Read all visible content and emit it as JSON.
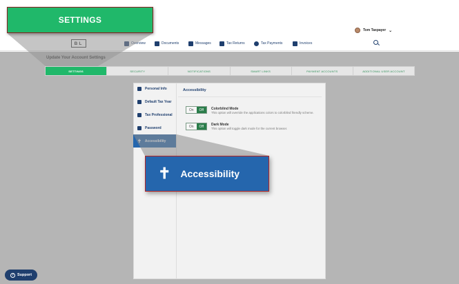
{
  "user": {
    "name": "Tom Taxpayer",
    "caret": "⌄"
  },
  "logo": "BL",
  "nav": [
    {
      "label": "Overview",
      "icon": "home-icon"
    },
    {
      "label": "Documents",
      "icon": "documents-icon"
    },
    {
      "label": "Messages",
      "icon": "messages-icon"
    },
    {
      "label": "Tax Returns",
      "icon": "tax-returns-icon"
    },
    {
      "label": "Tax Payments",
      "icon": "dollar-icon"
    },
    {
      "label": "Invoices",
      "icon": "invoice-icon"
    }
  ],
  "page_heading": "Update Your Account Settings",
  "tabs": [
    {
      "label": "SETTINGS",
      "active": true
    },
    {
      "label": "SECURITY",
      "active": false
    },
    {
      "label": "NOTIFICATIONS",
      "active": false
    },
    {
      "label": "SMART LINKS",
      "active": false
    },
    {
      "label": "PAYMENT ACCOUNTS",
      "active": false
    },
    {
      "label": "ADDITIONAL USER ACCOUNT",
      "active": false
    }
  ],
  "sidebar": [
    {
      "label": "Personal Info",
      "icon": "person-icon",
      "active": false
    },
    {
      "label": "Default Tax Year",
      "icon": "calendar-icon",
      "active": false
    },
    {
      "label": "Tax Professional",
      "icon": "briefcase-icon",
      "active": false
    },
    {
      "label": "Password",
      "icon": "lock-icon",
      "active": false
    },
    {
      "label": "Accessibility",
      "icon": "accessibility-icon",
      "active": true
    }
  ],
  "section_title": "Accessibility",
  "options": [
    {
      "title": "Colorblind Mode",
      "description": "This option will override the applications colors to colorblind friendly scheme.",
      "on_label": "On",
      "off_label": "Off",
      "state": "off"
    },
    {
      "title": "Dark Mode",
      "description": "This option will toggle dark mode for the current browser.",
      "on_label": "On",
      "off_label": "Off",
      "state": "off"
    }
  ],
  "callouts": {
    "settings": "SETTINGS",
    "accessibility": "Accessibility"
  },
  "support": {
    "label": "Support",
    "icon": "?"
  },
  "colors": {
    "accent_green": "#20b86a",
    "accent_blue": "#2566ad",
    "navy": "#1f3f6e",
    "callout_border": "#b42424"
  }
}
